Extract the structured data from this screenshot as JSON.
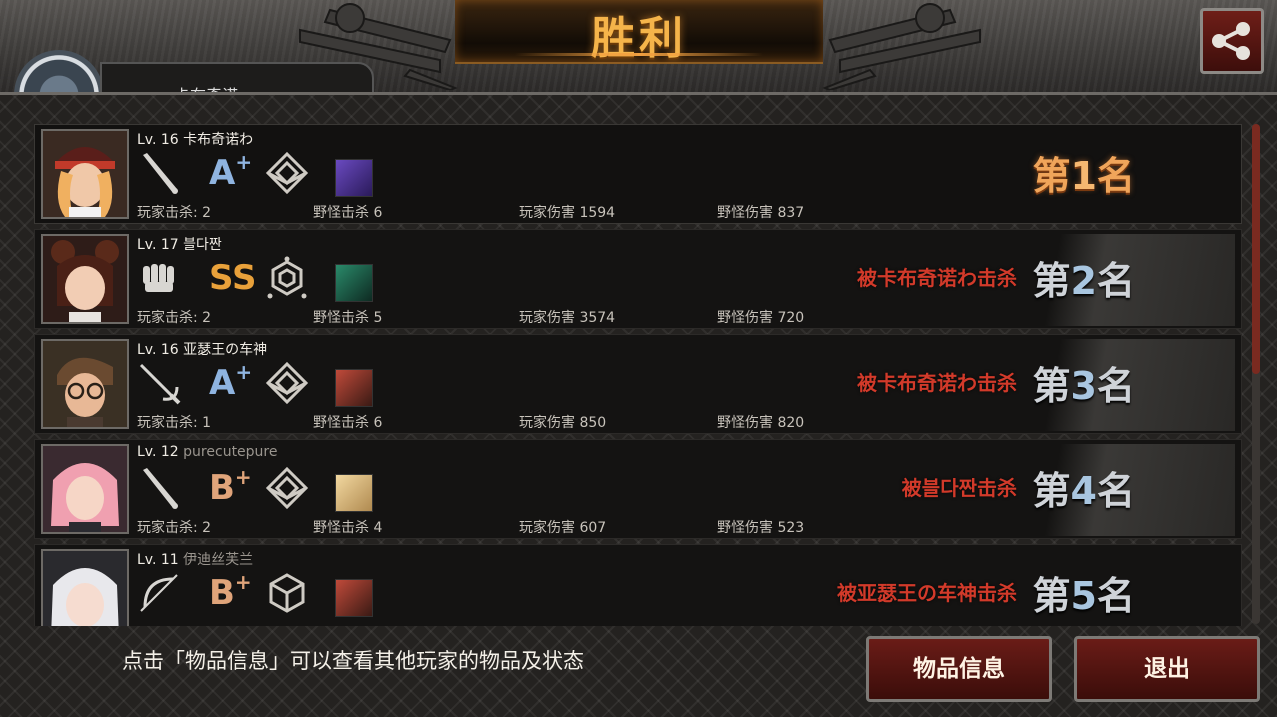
{
  "header": {
    "title": "胜利",
    "player_name_partial": "卡布奇诺"
  },
  "rows": [
    {
      "level": "Lv. 16",
      "name": "卡布奇诺わ",
      "weapon_icon": "bat-icon",
      "grade": "A",
      "grade_plus": "+",
      "class_icon": "diamond-emblem-icon",
      "player_kills": "玩家击杀: 2",
      "monster_kills": "野怪击杀 6",
      "player_damage": "玩家伤害 1594",
      "monster_damage": "野怪伤害 837",
      "killed_by": "",
      "rank_prefix": "第",
      "rank_num": "1",
      "rank_suffix": "名"
    },
    {
      "level": "Lv. 17",
      "name": "블다짠",
      "weapon_icon": "fist-icon",
      "grade": "SS",
      "grade_plus": "",
      "class_icon": "hexagon-emblem-icon",
      "player_kills": "玩家击杀: 2",
      "monster_kills": "野怪击杀 5",
      "player_damage": "玩家伤害 3574",
      "monster_damage": "野怪伤害 720",
      "killed_by": "被卡布奇诺わ击杀",
      "rank_prefix": "第",
      "rank_num": "2",
      "rank_suffix": "名"
    },
    {
      "level": "Lv. 16",
      "name": "亚瑟王の车神",
      "weapon_icon": "rapier-icon",
      "grade": "A",
      "grade_plus": "+",
      "class_icon": "diamond-emblem-icon",
      "player_kills": "玩家击杀: 1",
      "monster_kills": "野怪击杀 6",
      "player_damage": "玩家伤害 850",
      "monster_damage": "野怪伤害 820",
      "killed_by": "被卡布奇诺わ击杀",
      "rank_prefix": "第",
      "rank_num": "3",
      "rank_suffix": "名"
    },
    {
      "level": "Lv. 12",
      "name": "purecutepure",
      "weapon_icon": "bat-icon",
      "grade": "B",
      "grade_plus": "+",
      "class_icon": "diamond-emblem-icon",
      "player_kills": "玩家击杀: 2",
      "monster_kills": "野怪击杀 4",
      "player_damage": "玩家伤害 607",
      "monster_damage": "野怪伤害 523",
      "killed_by": "被블다짠击杀",
      "rank_prefix": "第",
      "rank_num": "4",
      "rank_suffix": "名"
    },
    {
      "level": "Lv. 11",
      "name": "伊迪丝芙兰",
      "weapon_icon": "bow-icon",
      "grade": "B",
      "grade_plus": "+",
      "class_icon": "cube-emblem-icon",
      "player_kills": "",
      "monster_kills": "",
      "player_damage": "",
      "monster_damage": "",
      "killed_by": "被亚瑟王の车神击杀",
      "rank_prefix": "第",
      "rank_num": "5",
      "rank_suffix": "名"
    }
  ],
  "footer": {
    "hint": "点击「物品信息」可以查看其他玩家的物品及状态",
    "items_button": "物品信息",
    "exit_button": "退出"
  },
  "colors": {
    "gold": "#f0a55a",
    "kill_red": "#d23a2a",
    "button_red": "#6a1c17"
  }
}
